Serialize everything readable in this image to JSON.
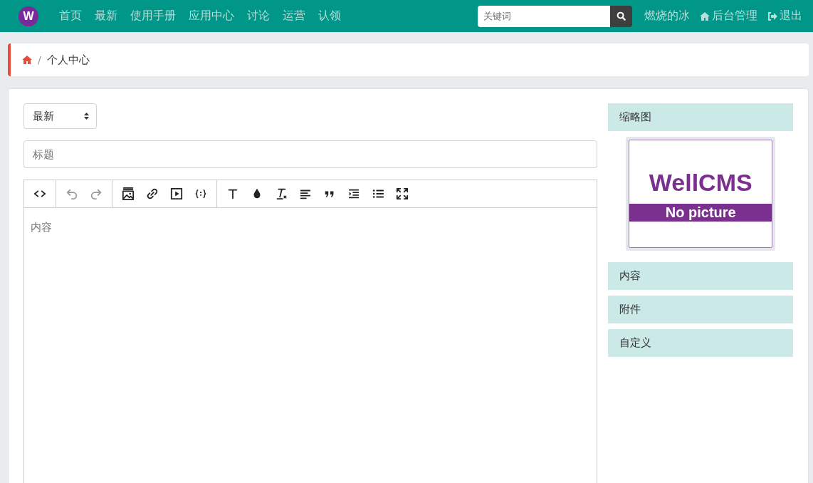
{
  "navbar": {
    "logo": "W",
    "links": [
      "首页",
      "最新",
      "使用手册",
      "应用中心",
      "讨论",
      "运营",
      "认领"
    ],
    "search": {
      "placeholder": "关键词"
    },
    "user": "燃烧的冰",
    "admin": "后台管理",
    "logout": "退出"
  },
  "breadcrumb": {
    "separator": "/",
    "items": [
      "个人中心"
    ]
  },
  "form": {
    "sort_select": {
      "value": "最新"
    },
    "title_field": {
      "placeholder": "标题"
    },
    "toolbar": [
      [
        {
          "kind": "code",
          "disabled": false
        }
      ],
      [
        {
          "kind": "undo",
          "disabled": true
        },
        {
          "kind": "redo",
          "disabled": true
        }
      ],
      [
        {
          "kind": "image",
          "disabled": false
        },
        {
          "kind": "link",
          "disabled": false
        },
        {
          "kind": "video",
          "disabled": false
        },
        {
          "kind": "braces",
          "disabled": false
        }
      ],
      [
        {
          "kind": "heading",
          "disabled": false
        },
        {
          "kind": "color",
          "disabled": false
        },
        {
          "kind": "clear",
          "disabled": false
        },
        {
          "kind": "align",
          "disabled": false
        },
        {
          "kind": "quote",
          "disabled": false
        },
        {
          "kind": "indent",
          "disabled": false
        },
        {
          "kind": "list",
          "disabled": false
        },
        {
          "kind": "fullscreen",
          "disabled": false
        }
      ]
    ],
    "content": {
      "placeholder": "内容"
    }
  },
  "sidebar": {
    "thumbnail": {
      "heading": "缩略图",
      "brand": "WellCMS",
      "caption": "No picture"
    },
    "sections": [
      "内容",
      "附件",
      "自定义"
    ]
  }
}
